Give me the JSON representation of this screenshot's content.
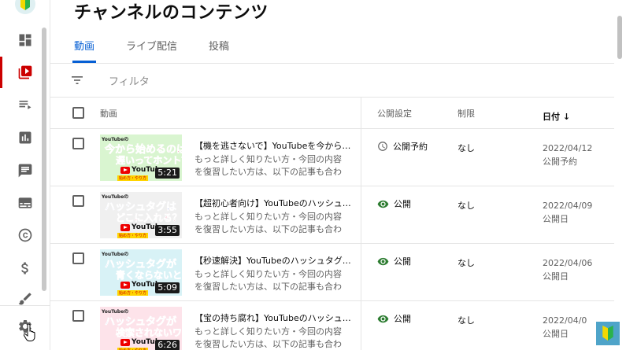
{
  "page": {
    "title": "チャンネルのコンテンツ"
  },
  "tabs": [
    {
      "label": "動画",
      "active": true
    },
    {
      "label": "ライブ配信",
      "active": false
    },
    {
      "label": "投稿",
      "active": false
    }
  ],
  "filter": {
    "placeholder": "フィルタ"
  },
  "table": {
    "headers": {
      "video": "動画",
      "visibility": "公開設定",
      "restrictions": "制限",
      "date": "日付 ↓"
    },
    "rows": [
      {
        "thumb": {
          "brand": "YouTubeの",
          "line1": "今から始めるのは",
          "line2": "遅いってホント？",
          "yt": "YouTube",
          "tag": "始め方・やり方",
          "duration": "5:21",
          "bg": "#d9f5d0",
          "c1": "#e0003c",
          "c2": "#e0003c"
        },
        "title": "【機を逃さないで】YouTubeを今から…",
        "desc": "もっと詳しく知りたい方・今回の内容を復習したい方は、以下の記事も合わせて…",
        "visibility": "公開予約",
        "visibility_icon": "clock-icon",
        "restriction": "なし",
        "date": "2022/04/12",
        "date_status": "公開予約"
      },
      {
        "thumb": {
          "brand": "YouTubeの",
          "line1": "ハッシュタグは",
          "line2": "どこに入れる？",
          "yt": "YouTube",
          "tag": "始め方・やり方",
          "duration": "3:55",
          "bg": "#f0f0f0",
          "c1": "#2f3fd0",
          "c2": "#e0003c"
        },
        "title": "【超初心者向け】YouTubeのハッシュ…",
        "desc": "もっと詳しく知りたい方・今回の内容を復習したい方は、以下の記事も合わせて…",
        "visibility": "公開",
        "visibility_icon": "eye-icon",
        "restriction": "なし",
        "date": "2022/04/09",
        "date_status": "公開日"
      },
      {
        "thumb": {
          "brand": "YouTubeの",
          "line1": "ハッシュタグが",
          "line2": "青くならないときは",
          "yt": "YouTube",
          "tag": "始め方・やり方",
          "duration": "5:09",
          "bg": "#d8f2f6",
          "c1": "#2f3fd0",
          "c2": "#2f3fd0"
        },
        "title": "【秒速解決】YouTubeのハッシュタグ…",
        "desc": "もっと詳しく知りたい方・今回の内容を復習したい方は、以下の記事も合わせて…",
        "visibility": "公開",
        "visibility_icon": "eye-icon",
        "restriction": "なし",
        "date": "2022/04/06",
        "date_status": "公開日"
      },
      {
        "thumb": {
          "brand": "YouTubeの",
          "line1": "ハッシュタグが",
          "line2": "検索されないワケ",
          "yt": "YouTube",
          "tag": "始め方・やり方",
          "duration": "6:26",
          "bg": "#fde3ea",
          "c1": "#2f3fd0",
          "c2": "#e0003c"
        },
        "title": "【宝の持ち腐れ】YouTubeのハッシュ…",
        "desc": "もっと詳しく知りたい方・今回の内容を復習したい方は、以下の記事も合わせて…",
        "visibility": "公開",
        "visibility_icon": "eye-icon",
        "restriction": "なし",
        "date": "2022/04/0",
        "date_status": "公開日"
      }
    ]
  },
  "sidebar": {
    "items": [
      {
        "icon": "dashboard-icon"
      },
      {
        "icon": "content-icon",
        "active": true
      },
      {
        "icon": "playlist-icon"
      },
      {
        "icon": "analytics-icon"
      },
      {
        "icon": "comments-icon"
      },
      {
        "icon": "subtitles-icon"
      },
      {
        "icon": "copyright-icon"
      },
      {
        "icon": "monetization-icon"
      },
      {
        "icon": "customization-icon"
      },
      {
        "icon": "settings-icon"
      }
    ]
  },
  "colors": {
    "accent": "#065fd4",
    "active": "#cc0000",
    "visible_green": "#2e7d32"
  }
}
